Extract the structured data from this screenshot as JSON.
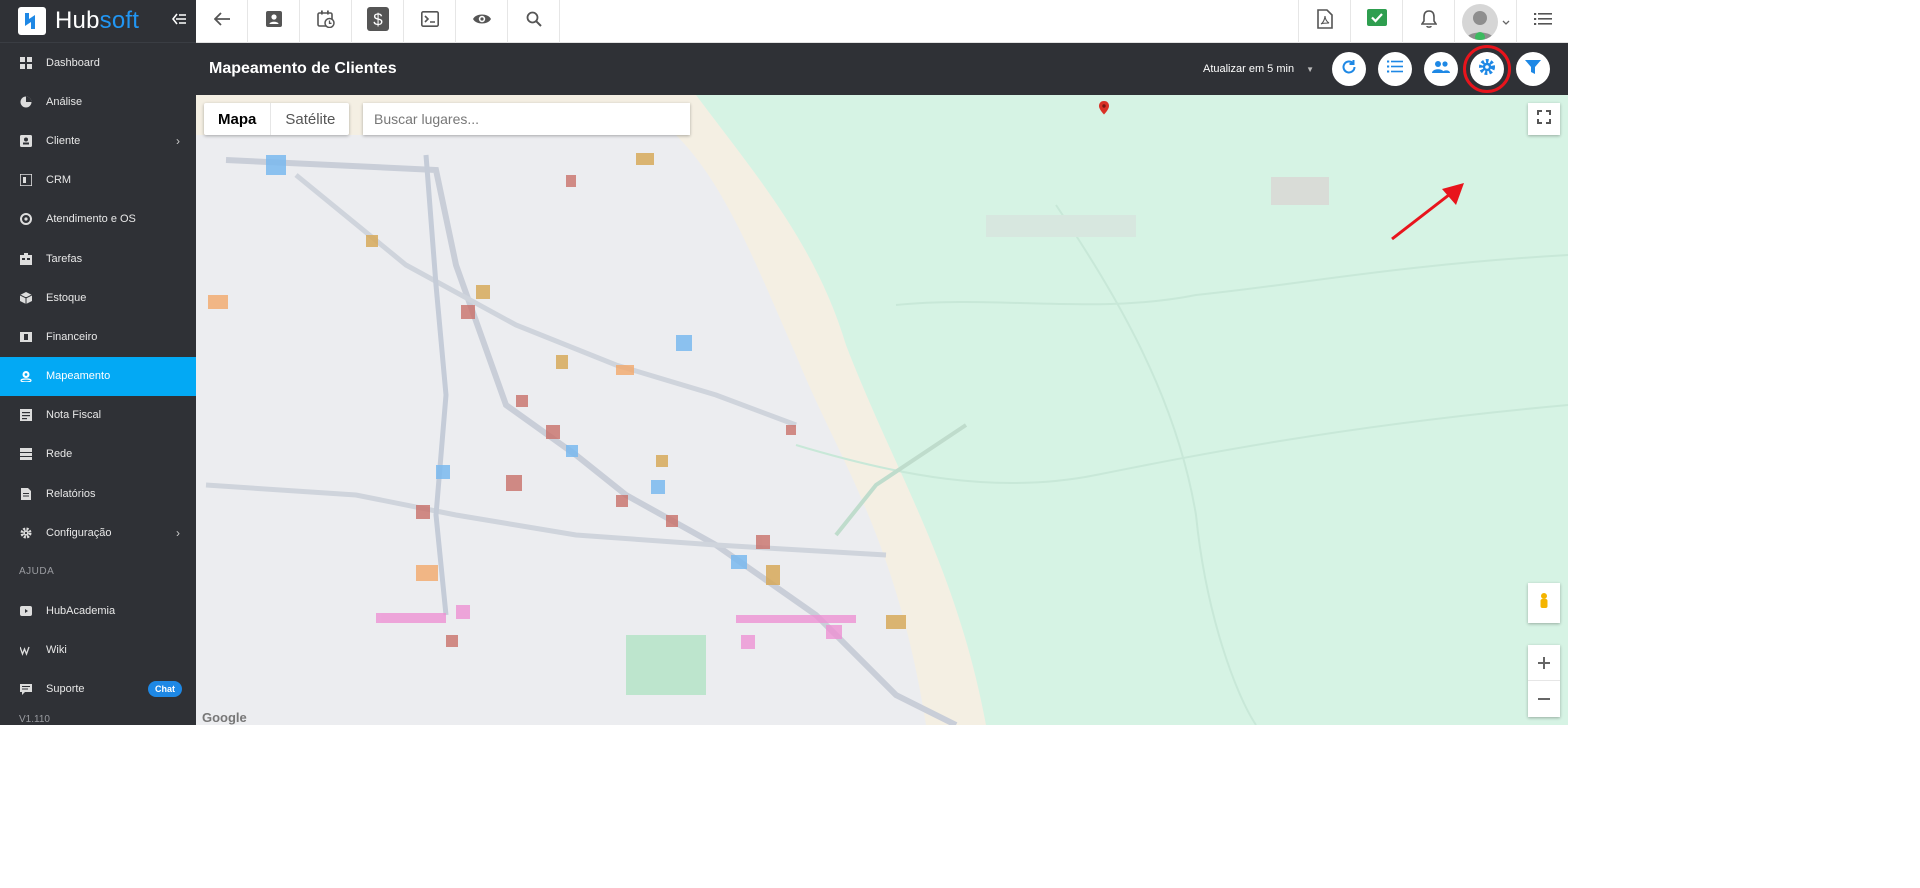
{
  "brand": {
    "name_part1": "Hub",
    "name_part2": "soft"
  },
  "sidebar": {
    "items": [
      {
        "label": "Dashboard",
        "icon": "dashboard-icon"
      },
      {
        "label": "Análise",
        "icon": "pie-chart-icon"
      },
      {
        "label": "Cliente",
        "icon": "contact-card-icon",
        "has_submenu": true
      },
      {
        "label": "CRM",
        "icon": "crm-icon"
      },
      {
        "label": "Atendimento e OS",
        "icon": "gear-clock-icon"
      },
      {
        "label": "Tarefas",
        "icon": "tasks-icon"
      },
      {
        "label": "Estoque",
        "icon": "box-icon"
      },
      {
        "label": "Financeiro",
        "icon": "money-icon"
      },
      {
        "label": "Mapeamento",
        "icon": "map-pin-icon",
        "active": true
      },
      {
        "label": "Nota Fiscal",
        "icon": "invoice-icon"
      },
      {
        "label": "Rede",
        "icon": "network-icon"
      },
      {
        "label": "Relatórios",
        "icon": "report-icon"
      },
      {
        "label": "Configuração",
        "icon": "gear-icon",
        "has_submenu": true
      }
    ],
    "help_section_label": "AJUDA",
    "help_items": [
      {
        "label": "HubAcademia",
        "icon": "play-icon"
      },
      {
        "label": "Wiki",
        "icon": "wiki-icon"
      },
      {
        "label": "Suporte",
        "icon": "chat-icon",
        "badge": "Chat"
      }
    ],
    "version": "V1.110"
  },
  "header": {
    "title": "Mapeamento de Clientes",
    "refresh_label": "Atualizar em 5 min"
  },
  "map": {
    "type_buttons": [
      "Mapa",
      "Satélite"
    ],
    "search_placeholder": "Buscar lugares...",
    "google_label": "Google"
  },
  "colors": {
    "sidebar_bg": "#2f3136",
    "active": "#03a9f4",
    "accent_blue": "#1e88e5",
    "highlight_red": "#e8141c",
    "map_bg": "#d6f3e4"
  }
}
